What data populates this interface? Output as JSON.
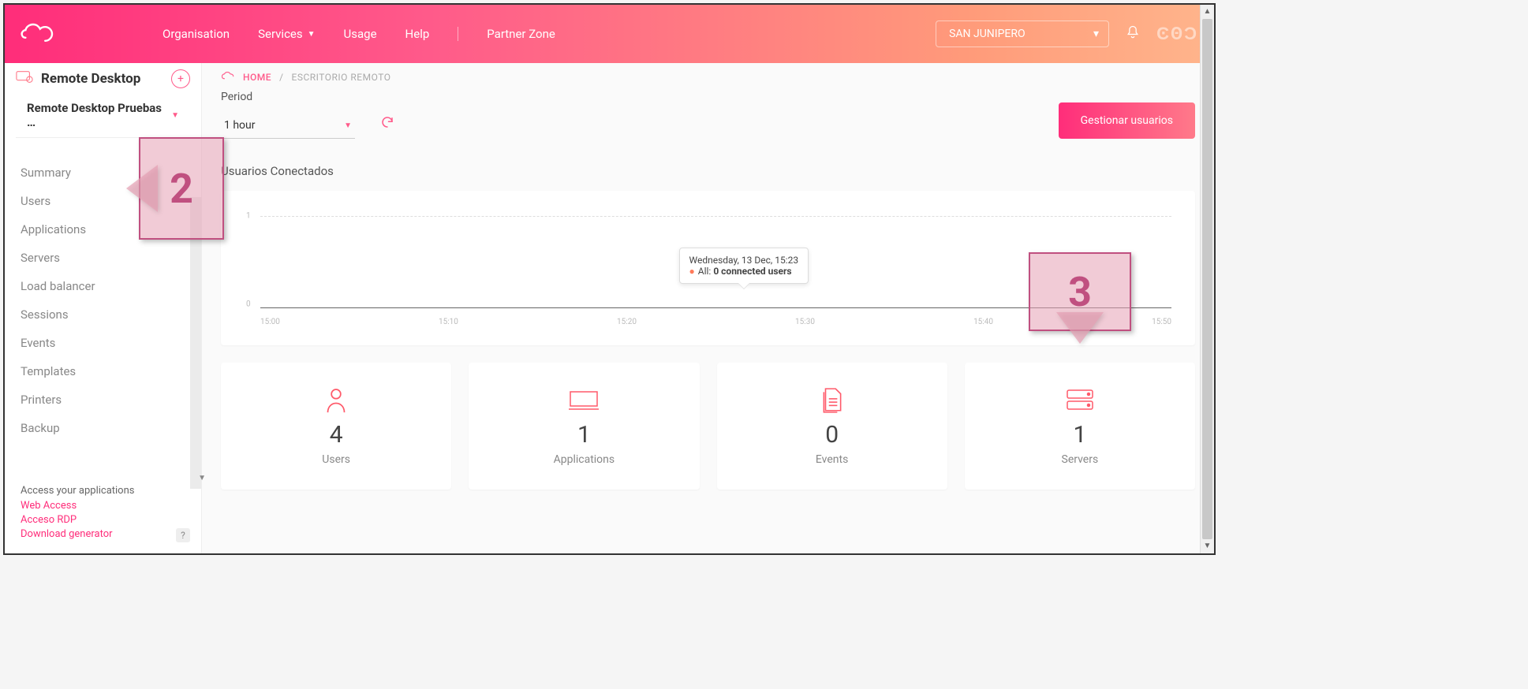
{
  "topnav": {
    "items": [
      "Organisation",
      "Services",
      "Usage",
      "Help",
      "Partner Zone"
    ],
    "org_selected": "SAN JUNIPERO"
  },
  "sidebar": {
    "title": "Remote Desktop",
    "instance": "Remote Desktop Pruebas …",
    "items": [
      "Summary",
      "Users",
      "Applications",
      "Servers",
      "Load balancer",
      "Sessions",
      "Events",
      "Templates",
      "Printers",
      "Backup"
    ],
    "footer_header": "Access your applications",
    "footer_links": [
      "Web Access",
      "Acceso RDP",
      "Download generator"
    ]
  },
  "breadcrumb": {
    "home": "HOME",
    "current": "ESCRITORIO REMOTO"
  },
  "period": {
    "label": "Period",
    "value": "1 hour"
  },
  "primary_button": "Gestionar usuarios",
  "chart": {
    "title": "Usuarios Conectados",
    "tooltip_date": "Wednesday, 13 Dec, 15:23",
    "tooltip_series_prefix": "All:",
    "tooltip_value": "0 connected users"
  },
  "chart_data": {
    "type": "line",
    "title": "Usuarios Conectados",
    "xlabel": "",
    "ylabel": "",
    "ylim": [
      0,
      1
    ],
    "y_ticks": [
      0,
      1
    ],
    "x_ticks": [
      "15:00",
      "15:10",
      "15:20",
      "15:30",
      "15:40",
      "15:50"
    ],
    "series": [
      {
        "name": "All",
        "values": [
          0,
          0,
          0,
          0,
          0,
          0
        ]
      }
    ],
    "tooltip_point": {
      "x": "15:23",
      "series": "All",
      "value": 0,
      "unit": "connected users"
    }
  },
  "cards": [
    {
      "icon": "user-icon",
      "value": "4",
      "label": "Users"
    },
    {
      "icon": "monitor-icon",
      "value": "1",
      "label": "Applications"
    },
    {
      "icon": "document-icon",
      "value": "0",
      "label": "Events"
    },
    {
      "icon": "server-icon",
      "value": "1",
      "label": "Servers"
    }
  ],
  "annotations": {
    "step2": "2",
    "step3": "3"
  },
  "colors": {
    "accent": "#ff2d7a",
    "gradient_end": "#ffb58c"
  }
}
